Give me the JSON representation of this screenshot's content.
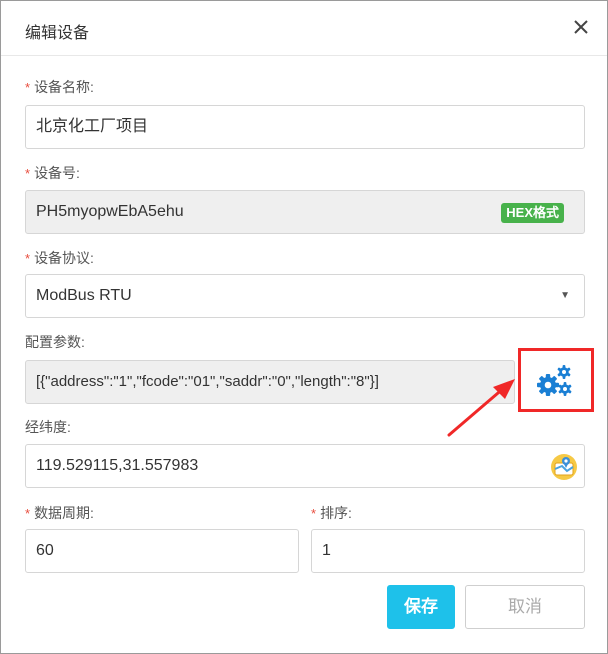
{
  "dialog": {
    "title": "编辑设备"
  },
  "fields": {
    "device_name": {
      "label": "设备名称:",
      "required": true,
      "value": "北京化工厂项目"
    },
    "device_no": {
      "label": "设备号:",
      "required": true,
      "value": "PH5myopwEbA5ehu",
      "badge": "HEX格式"
    },
    "protocol": {
      "label": "设备协议:",
      "required": true,
      "value": "ModBus RTU",
      "arrow": "▼"
    },
    "config": {
      "label": "配置参数:",
      "required": false,
      "value": "[{\"address\":\"1\",\"fcode\":\"01\",\"saddr\":\"0\",\"length\":\"8\"}]"
    },
    "coords": {
      "label": "经纬度:",
      "required": false,
      "value": "119.529115,31.557983"
    },
    "period": {
      "label": "数据周期:",
      "required": true,
      "value": "60"
    },
    "sort": {
      "label": "排序:",
      "required": true,
      "value": "1"
    }
  },
  "required_mark": "*",
  "buttons": {
    "save": "保存",
    "cancel": "取消"
  },
  "icons": {
    "close": "close-icon",
    "gear": "gears-icon",
    "map": "map-location-icon",
    "dropdown": "caret-down-icon"
  },
  "colors": {
    "accent": "#1ec1ea",
    "badge": "#48b24b",
    "required": "#e84c3d",
    "highlight": "#f02828",
    "gear": "#1a7fd4"
  }
}
